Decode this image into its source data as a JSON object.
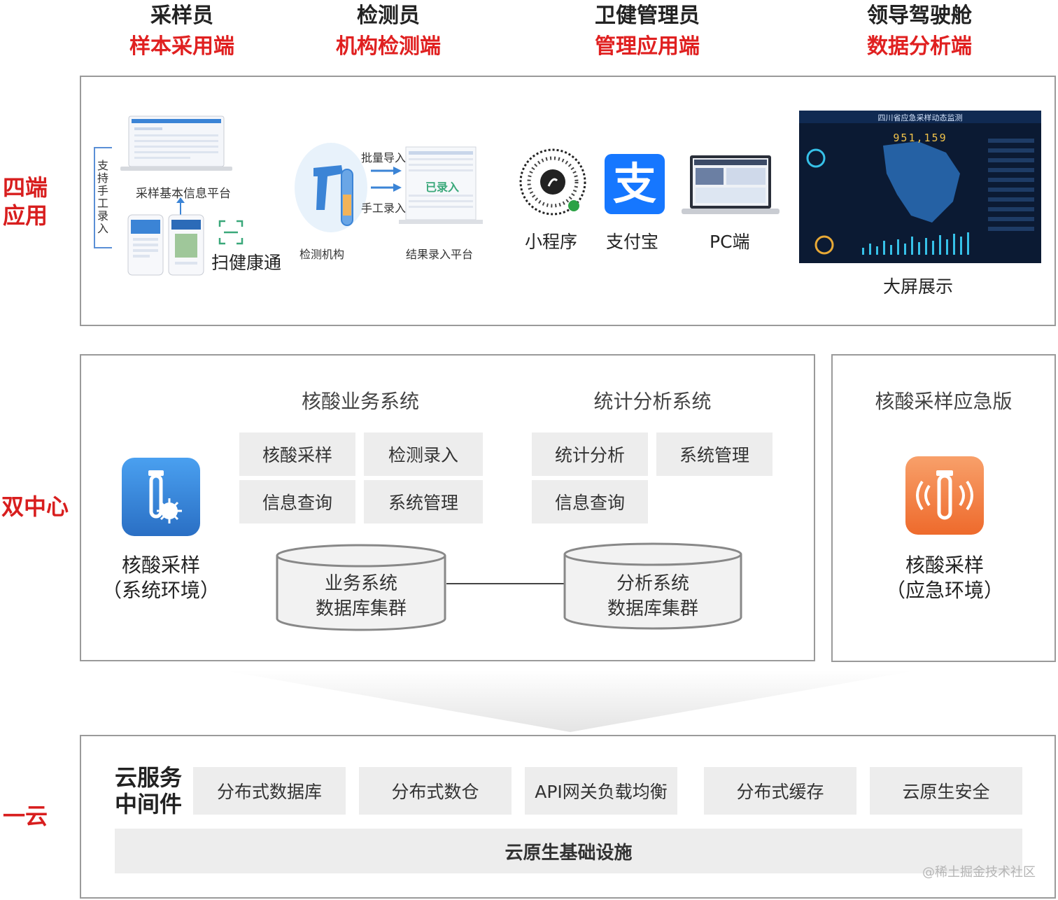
{
  "roles": [
    {
      "title": "采样员",
      "sub": "样本采用端"
    },
    {
      "title": "检测员",
      "sub": "机构检测端"
    },
    {
      "title": "卫健管理员",
      "sub": "管理应用端"
    },
    {
      "title": "领导驾驶舱",
      "sub": "数据分析端"
    }
  ],
  "side_labels": {
    "four_ends": "四端\n应用",
    "dual_center": "双中心",
    "one_cloud": "一云"
  },
  "apps": {
    "manual_entry": "支持手工录入",
    "sampling_platform": "采样基本信息平台",
    "scan_health_code": "扫健康通",
    "batch_import": "批量导入",
    "manual_input": "手工录入",
    "entered_badge": "已录入",
    "testing_org": "检测机构",
    "result_platform": "结果录入平台",
    "mini_program": "小程序",
    "alipay": "支付宝",
    "alipay_glyph": "支",
    "pc": "PC端",
    "big_screen": "大屏展示",
    "screen_title": "四川省应急采样动态监测",
    "screen_number": "951,159"
  },
  "dual_center": {
    "business_system": "核酸业务系统",
    "stats_system": "统计分析系统",
    "emergency_system": "核酸采样应急版",
    "business_tiles": [
      "核酸采样",
      "检测录入",
      "信息查询",
      "系统管理"
    ],
    "stats_tiles": [
      "统计分析",
      "系统管理",
      "信息查询"
    ],
    "env_caption_1": "核酸采样",
    "env_caption_2": "（系统环境）",
    "emerg_caption_1": "核酸采样",
    "emerg_caption_2": "（应急环境）",
    "db_business_1": "业务系统",
    "db_business_2": "数据库集群",
    "db_stats_1": "分析系统",
    "db_stats_2": "数据库集群"
  },
  "cloud": {
    "middleware_1": "云服务",
    "middleware_2": "中间件",
    "tiles": [
      "分布式数据库",
      "分布式数仓",
      "API网关负载均衡",
      "分布式缓存",
      "云原生安全"
    ],
    "infra": "云原生基础设施"
  },
  "watermark": "@稀土掘金技术社区",
  "colors": {
    "accent_red": "#e02020",
    "side_red": "#d81e1e",
    "tile_gray": "#ededed",
    "blue_icon": "#3b84d6",
    "orange_icon": "#f0793a"
  }
}
